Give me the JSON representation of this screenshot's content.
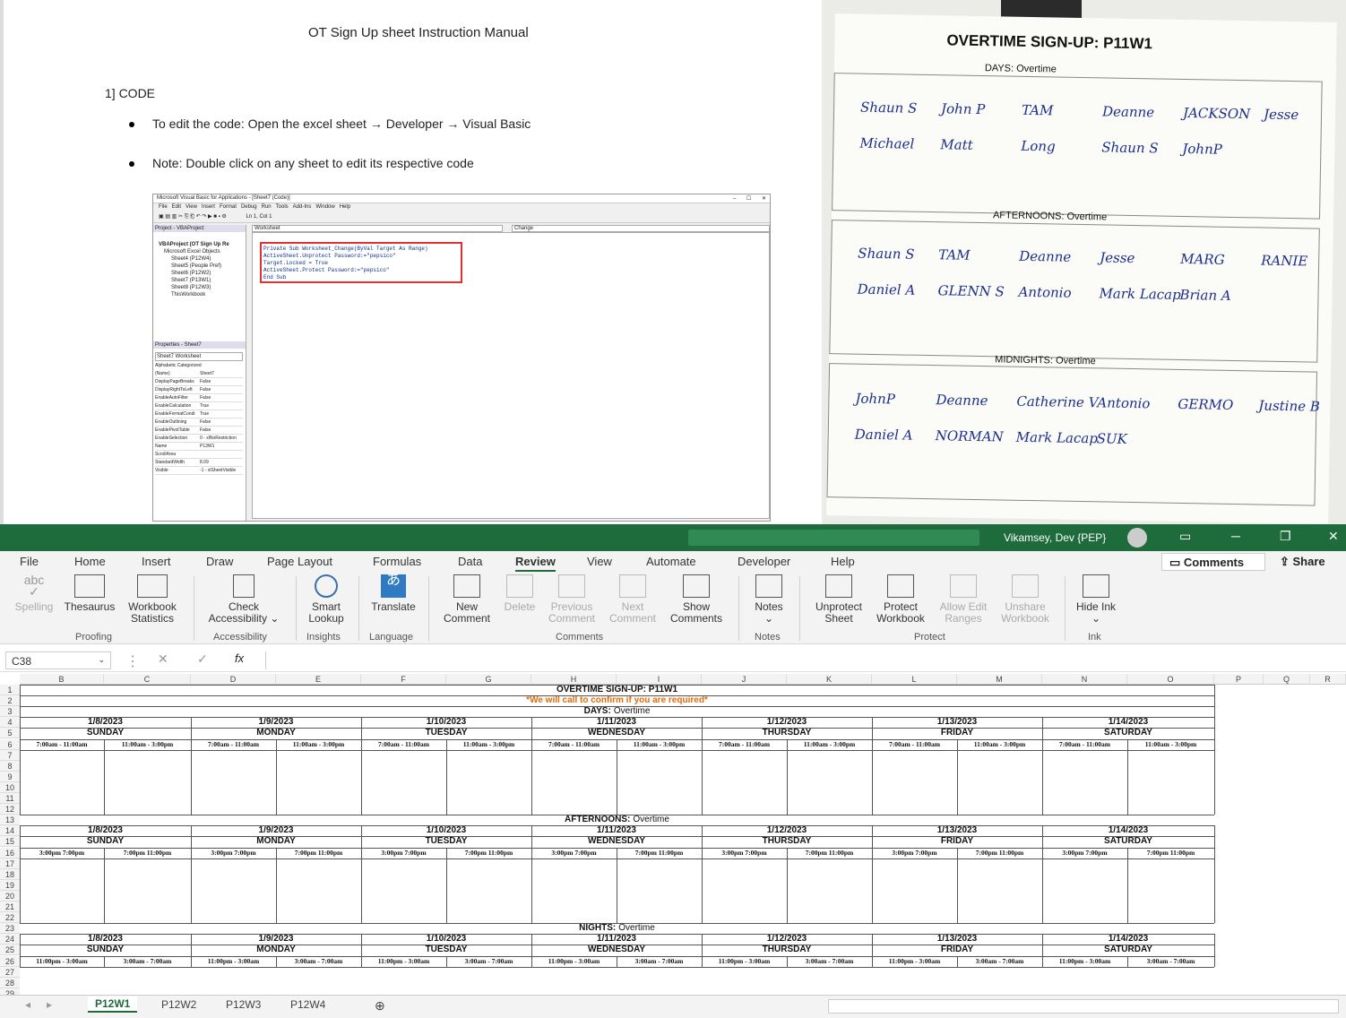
{
  "document": {
    "title": "OT Sign Up sheet Instruction Manual",
    "heading": "1] CODE",
    "bullets": [
      "To edit the code: Open the excel sheet → Developer → Visual Basic",
      "Note: Double click on any sheet to edit its respective code"
    ],
    "vba": {
      "window_title": "Microsoft Visual Basic for Applications - [Sheet7 (Code)]",
      "menu": [
        "File",
        "Edit",
        "View",
        "Insert",
        "Format",
        "Debug",
        "Run",
        "Tools",
        "Add-Ins",
        "Window",
        "Help"
      ],
      "position": "Ln 1, Col 1",
      "project_title": "Project - VBAProject",
      "project_root": "VBAProject (OT Sign Up Re",
      "objects_folder": "Microsoft Excel Objects",
      "tree": [
        "Sheet4 (P12W4)",
        "Sheet5 (People Pref)",
        "Sheet6 (P12W2)",
        "Sheet7 (P13W1)",
        "Sheet8 (P12W3)",
        "ThisWorkbook"
      ],
      "properties_title": "Properties - Sheet7",
      "properties_object": "Sheet7 Worksheet",
      "prop_tabs": [
        "Alphabetic",
        "Categorized"
      ],
      "properties": [
        [
          "(Name)",
          "Sheet7"
        ],
        [
          "DisplayPageBreaks",
          "False"
        ],
        [
          "DisplayRightToLeft",
          "False"
        ],
        [
          "EnableAutoFilter",
          "False"
        ],
        [
          "EnableCalculation",
          "True"
        ],
        [
          "EnableFormatCondi",
          "True"
        ],
        [
          "EnableOutlining",
          "False"
        ],
        [
          "EnablePivotTable",
          "False"
        ],
        [
          "EnableSelection",
          "0 - xlNoRestriction"
        ],
        [
          "Name",
          "P13W1"
        ],
        [
          "ScrollArea",
          ""
        ],
        [
          "StandardWidth",
          "8.09"
        ],
        [
          "Visible",
          "-1 - xlSheetVisible"
        ]
      ],
      "object_dropdown": "Worksheet",
      "proc_dropdown": "Change",
      "code": [
        "Private Sub Worksheet_Change(ByVal Target As Range)",
        "ActiveSheet.Unprotect Password:=\"pepsico\"",
        "Target.Locked = True",
        "ActiveSheet.Protect Password:=\"pepsico\"",
        "End Sub"
      ]
    }
  },
  "photo": {
    "title": "OVERTIME SIGN-UP: P11W1",
    "sections": [
      "DAYS: Overtime",
      "AFTERNOONS: Overtime",
      "MIDNIGHTS: Overtime"
    ],
    "names_days": [
      "Shaun S",
      "John P",
      "TAM",
      "Deanne",
      "JACKSON",
      "Jesse",
      "Michael",
      "Matt",
      "Long",
      "Shaun S",
      "JohnP"
    ],
    "names_afternoons": [
      "Shaun S",
      "TAM",
      "Deanne",
      "Jesse",
      "MARG",
      "RANIE",
      "Daniel A",
      "GLENN S",
      "Antonio",
      "Mark Lacap",
      "Brian A"
    ],
    "names_nights": [
      "JohnP",
      "Deanne",
      "Catherine V",
      "Antonio",
      "GERMO",
      "Justine B",
      "Daniel A",
      "NORMAN",
      "Mark Lacap",
      "SUK"
    ]
  },
  "excel": {
    "user": "Vikamsey, Dev {PEP}",
    "tabs": [
      "File",
      "Home",
      "Insert",
      "Draw",
      "Page Layout",
      "Formulas",
      "Data",
      "Review",
      "View",
      "Automate",
      "Developer",
      "Help"
    ],
    "active_tab": "Review",
    "comments_btn": "Comments",
    "share_btn": "Share",
    "groups": [
      {
        "name": "Proofing",
        "buttons": [
          "Spelling",
          "Thesaurus",
          "Workbook Statistics"
        ]
      },
      {
        "name": "Accessibility",
        "buttons": [
          "Check Accessibility"
        ]
      },
      {
        "name": "Insights",
        "buttons": [
          "Smart Lookup"
        ]
      },
      {
        "name": "Language",
        "buttons": [
          "Translate"
        ]
      },
      {
        "name": "Comments",
        "buttons": [
          "New Comment",
          "Delete",
          "Previous Comment",
          "Next Comment",
          "Show Comments"
        ]
      },
      {
        "name": "Notes",
        "buttons": [
          "Notes"
        ]
      },
      {
        "name": "Protect",
        "buttons": [
          "Unprotect Sheet",
          "Protect Workbook",
          "Allow Edit Ranges",
          "Unshare Workbook"
        ]
      },
      {
        "name": "Ink",
        "buttons": [
          "Hide Ink"
        ]
      }
    ],
    "namebox": "C38",
    "columns": [
      "B",
      "C",
      "D",
      "E",
      "F",
      "G",
      "H",
      "I",
      "J",
      "K",
      "L",
      "M",
      "N",
      "O",
      "P",
      "Q",
      "R"
    ],
    "sheet_title": "OVERTIME SIGN-UP: P11W1",
    "subtitle": "*We will call to confirm if you are required*",
    "sections": [
      {
        "label": "DAYS:",
        "suffix": "Overtime",
        "shifts": [
          "7:00am - 11:00am",
          "11:00am - 3:00pm"
        ]
      },
      {
        "label": "AFTERNOONS:",
        "suffix": "Overtime",
        "shifts": [
          "3:00pm  7:00pm",
          "7:00pm  11:00pm"
        ]
      },
      {
        "label": "NIGHTS:",
        "suffix": "Overtime",
        "shifts": [
          "11:00pm - 3:00am",
          "3:00am - 7:00am"
        ]
      }
    ],
    "dates": [
      "1/8/2023",
      "1/9/2023",
      "1/10/2023",
      "1/11/2023",
      "1/12/2023",
      "1/13/2023",
      "1/14/2023"
    ],
    "days": [
      "SUNDAY",
      "MONDAY",
      "TUESDAY",
      "WEDNESDAY",
      "THURSDAY",
      "FRIDAY",
      "SATURDAY"
    ],
    "sheet_tabs": [
      "P12W1",
      "P12W2",
      "P12W3",
      "P12W4"
    ],
    "active_sheet": "P12W1"
  }
}
